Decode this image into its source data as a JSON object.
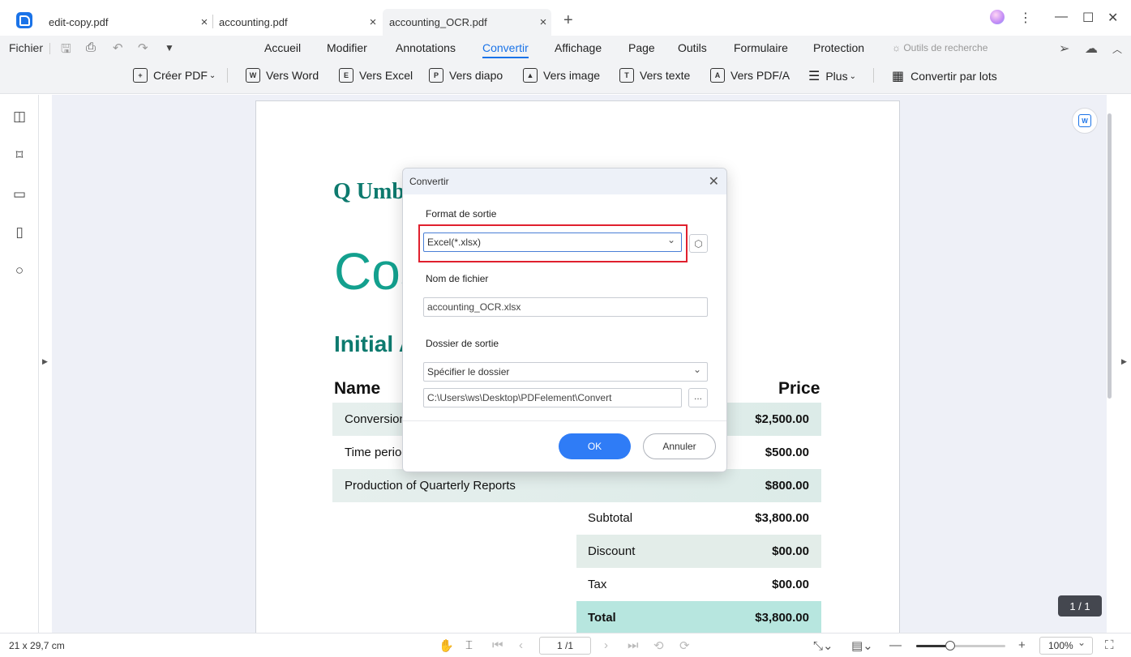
{
  "tabs": [
    {
      "label": "edit-copy.pdf",
      "active": false
    },
    {
      "label": "accounting.pdf",
      "active": false
    },
    {
      "label": "accounting_OCR.pdf",
      "active": true
    }
  ],
  "menubar": {
    "file_label": "Fichier",
    "items": [
      "Accueil",
      "Modifier",
      "Annotations",
      "Convertir",
      "Affichage",
      "Page",
      "Outils",
      "Formulaire",
      "Protection"
    ],
    "active_item": "Convertir",
    "search_tools_label": "Outils de recherche"
  },
  "ribbon": {
    "create_pdf": "Créer PDF",
    "to_word": "Vers Word",
    "to_excel": "Vers Excel",
    "to_ppt": "Vers diapo",
    "to_image": "Vers image",
    "to_text": "Vers texte",
    "to_pdfa": "Vers PDF/A",
    "more": "Plus",
    "batch": "Convertir par lots"
  },
  "document": {
    "company_fragment": "Q Umb",
    "title_fragment": "Cos",
    "subtitle_fragment": "Initial A",
    "header_name": "Name",
    "header_price": "Price",
    "rows": [
      {
        "desc": "Conversion",
        "amount": "$2,500.00"
      },
      {
        "desc": "Time period",
        "amount": "$500.00"
      },
      {
        "desc": "Production of Quarterly Reports",
        "amount": "$800.00"
      }
    ],
    "summary": [
      {
        "label": "Subtotal",
        "value": "$3,800.00"
      },
      {
        "label": "Discount",
        "value": "$00.00"
      },
      {
        "label": "Tax",
        "value": "$00.00"
      },
      {
        "label": "Total",
        "value": "$3,800.00"
      }
    ]
  },
  "dialog": {
    "title": "Convertir",
    "output_format_label": "Format de sortie",
    "output_format_value": "Excel(*.xlsx)",
    "filename_label": "Nom de fichier",
    "filename_value": "accounting_OCR.xlsx",
    "output_folder_label": "Dossier de sortie",
    "folder_mode_value": "Spécifier le dossier",
    "folder_path_value": "C:\\Users\\ws\\Desktop\\PDFelement\\Convert",
    "browse_label": "...",
    "ok_label": "OK",
    "cancel_label": "Annuler"
  },
  "status": {
    "page_size": "21 x 29,7 cm",
    "page_field": "1 /1",
    "page_badge": "1 / 1",
    "zoom": "100%",
    "zoom_fraction": 0.38
  },
  "colors": {
    "accent": "#1a73e8",
    "highlight_border": "#e0202e",
    "doc_teal": "#13a08e"
  }
}
